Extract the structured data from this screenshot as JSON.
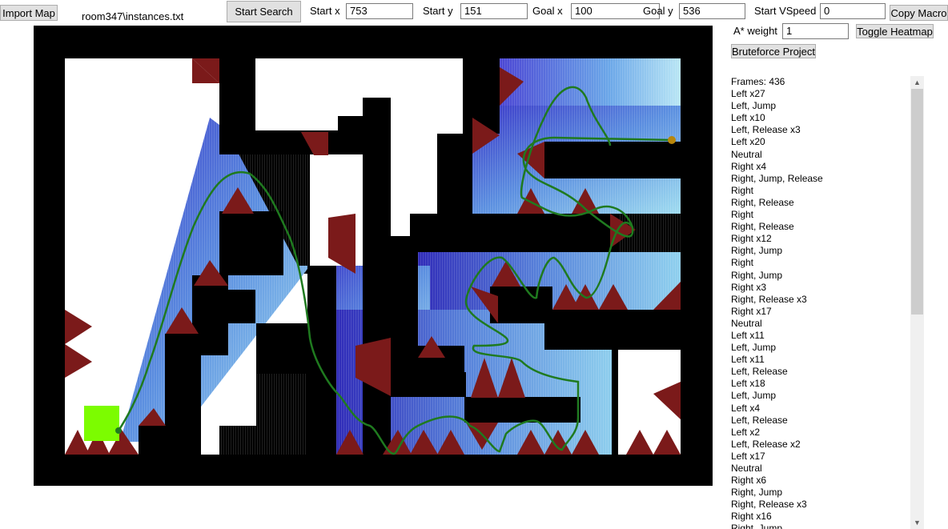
{
  "toolbar": {
    "import_label": "Import Map",
    "file_name": "room347\\instances.txt",
    "start_search_label": "Start Search",
    "start_x_label": "Start x",
    "start_x_value": "753",
    "start_y_label": "Start y",
    "start_y_value": "151",
    "goal_x_label": "Goal x",
    "goal_x_value": "100",
    "goal_y_label": "Goal y",
    "goal_y_value": "536",
    "start_vspeed_label": "Start VSpeed",
    "start_vspeed_value": "0",
    "copy_macro_label": "Copy Macro",
    "astar_weight_label": "A* weight",
    "astar_weight_value": "1",
    "toggle_heatmap_label": "Toggle Heatmap",
    "bruteforce_label": "Bruteforce Project"
  },
  "macro": {
    "lines": [
      "Frames: 436",
      "Left x27",
      "Left, Jump",
      "Left x10",
      "Left, Release x3",
      "Left x20",
      "Neutral",
      "Right x4",
      "Right, Jump, Release",
      "Right",
      "Right, Release",
      "Right",
      "Right, Release",
      "Right x12",
      "Right, Jump",
      "Right",
      "Right, Jump",
      "Right x3",
      "Right, Release x3",
      "Right x17",
      "Neutral",
      "Left x11",
      "Left, Jump",
      "Left x11",
      "Left, Release",
      "Left x18",
      "Left, Jump",
      "Left x4",
      "Left, Release",
      "Left x2",
      "Left, Release x2",
      "Left x17",
      "Neutral",
      "Right x6",
      "Right, Jump",
      "Right, Release x3",
      "Right x16",
      "Right, Jump"
    ]
  },
  "colors": {
    "wall": "#000000",
    "open": "#ffffff",
    "spike": "#7b1a1a",
    "path": "#1f7a1f",
    "goal_marker": "#7cfc00",
    "start_marker": "#b8860b",
    "heat_dark": "#3a37c8",
    "heat_light": "#9fdcf0"
  }
}
